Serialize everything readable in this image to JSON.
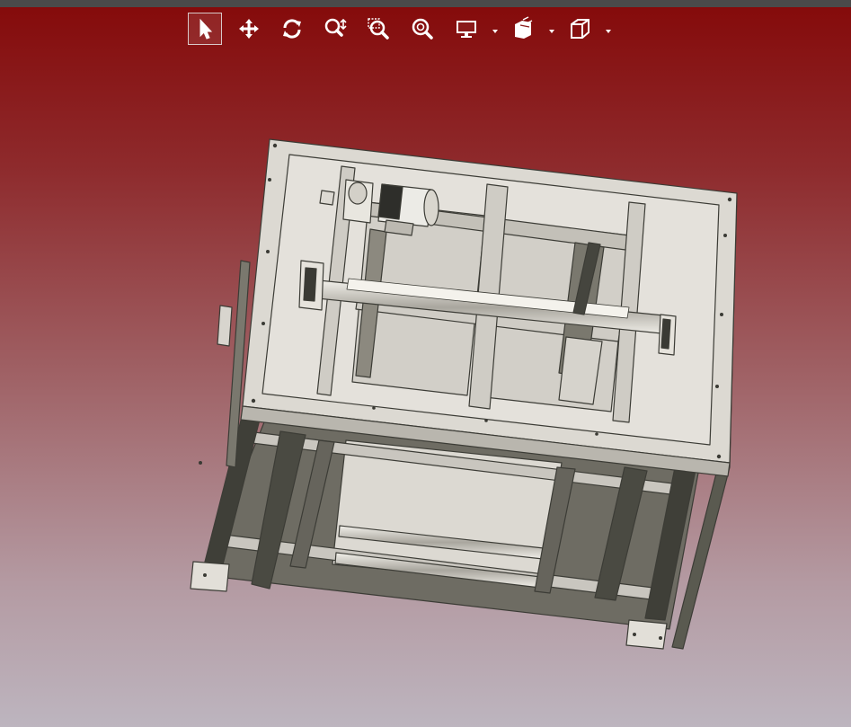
{
  "app": {
    "kind": "3d-cad-viewer"
  },
  "toolbar": {
    "tools": [
      {
        "id": "select",
        "icon": "select-arrow-icon",
        "active": true
      },
      {
        "id": "pan",
        "icon": "pan-move-icon",
        "active": false
      },
      {
        "id": "rotate",
        "icon": "rotate-icon",
        "active": false
      },
      {
        "id": "zoom",
        "icon": "zoom-icon",
        "active": false
      },
      {
        "id": "zoom-window",
        "icon": "zoom-window-icon",
        "active": false
      },
      {
        "id": "zoom-fit",
        "icon": "zoom-fit-icon",
        "active": false
      },
      {
        "id": "display-mode",
        "icon": "monitor-icon",
        "dropdown": true
      },
      {
        "id": "section-view",
        "icon": "section-view-icon",
        "dropdown": true
      },
      {
        "id": "standard-views",
        "icon": "cube-view-icon",
        "dropdown": true
      }
    ]
  },
  "colors": {
    "topbar": "#4a4a4a",
    "background_top": "#850b0b",
    "background_bottom": "#bdb5bf",
    "model_fill": "#dedbd4",
    "model_dark": "#4a4a42",
    "toolbar_icon": "#ffffff"
  }
}
